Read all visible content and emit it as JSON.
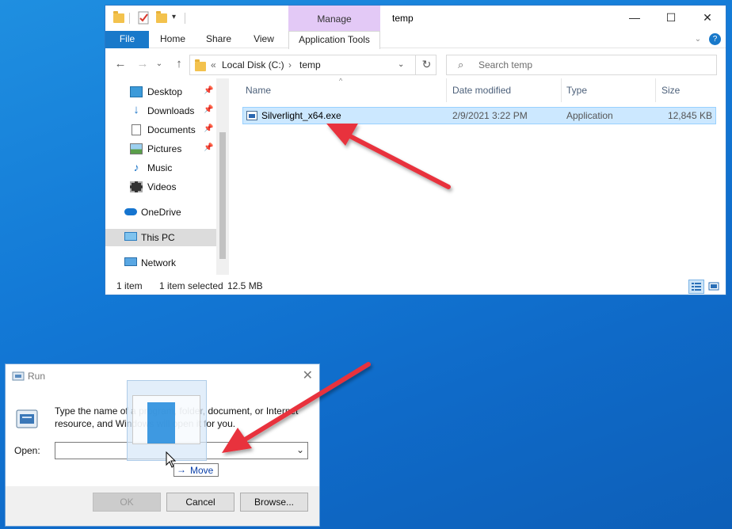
{
  "explorer": {
    "window_title": "temp",
    "contextual_tab": "Manage",
    "ribbon_tabs": [
      "File",
      "Home",
      "Share",
      "View",
      "Application Tools"
    ],
    "breadcrumb": {
      "prefix": "«",
      "items": [
        "Local Disk (C:)",
        "temp"
      ],
      "sep": "›"
    },
    "search_placeholder": "Search temp",
    "sidebar": [
      {
        "label": "Desktop",
        "icon": "desktop-icon",
        "pinned": true
      },
      {
        "label": "Downloads",
        "icon": "downloads-icon",
        "pinned": true
      },
      {
        "label": "Documents",
        "icon": "documents-icon",
        "pinned": true
      },
      {
        "label": "Pictures",
        "icon": "pictures-icon",
        "pinned": true
      },
      {
        "label": "Music",
        "icon": "music-icon",
        "pinned": false
      },
      {
        "label": "Videos",
        "icon": "videos-icon",
        "pinned": false
      },
      {
        "label": "OneDrive",
        "icon": "onedrive-icon",
        "pinned": false
      },
      {
        "label": "This PC",
        "icon": "this-pc-icon",
        "pinned": false,
        "selected": true
      },
      {
        "label": "Network",
        "icon": "network-icon",
        "pinned": false
      }
    ],
    "columns": [
      "Name",
      "Date modified",
      "Type",
      "Size"
    ],
    "files": [
      {
        "name": "Silverlight_x64.exe",
        "date": "2/9/2021 3:22 PM",
        "type": "Application",
        "size": "12,845 KB",
        "selected": true
      }
    ],
    "status": {
      "count": "1 item",
      "selection": "1 item selected",
      "size": "12.5 MB"
    }
  },
  "run_dialog": {
    "title": "Run",
    "description": "Type the name of a program, folder, document, or Internet resource, and Windows will open it for you.",
    "open_label": "Open:",
    "open_value": "",
    "buttons": {
      "ok": "OK",
      "cancel": "Cancel",
      "browse": "Browse..."
    }
  },
  "drag": {
    "tooltip": "Move",
    "tooltip_arrow": "→"
  },
  "colors": {
    "desktop": "#1379d6",
    "accent": "#1979ca",
    "selection": "#cce8ff",
    "annotation_arrow": "#e8333d",
    "manage_tab": "#e3c9f6"
  }
}
